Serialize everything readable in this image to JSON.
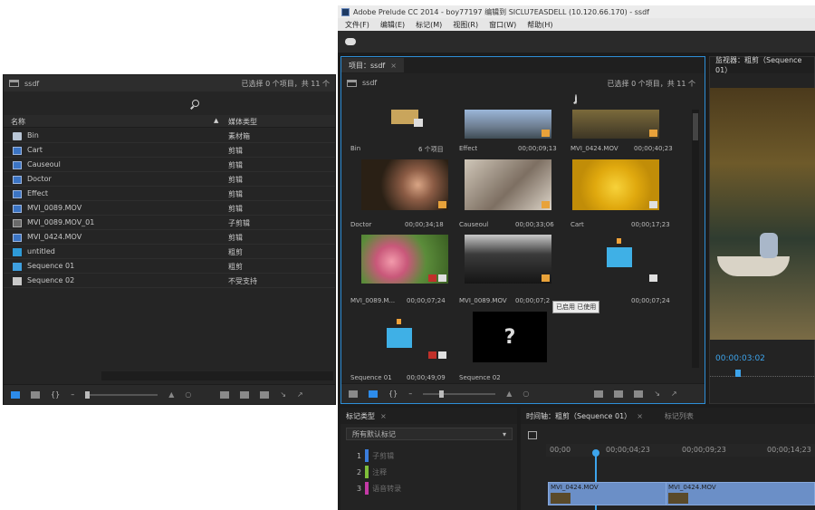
{
  "left_panel": {
    "bin_name": "ssdf",
    "selection_info": "已选择 0 个项目，共 11 个",
    "col_name": "名称",
    "col_type": "媒体类型",
    "rows": [
      {
        "name": "Bin",
        "type": "素材箱",
        "icon": "folder-icon"
      },
      {
        "name": "Cart",
        "type": "剪辑",
        "icon": "clip-icon"
      },
      {
        "name": "Causeoul",
        "type": "剪辑",
        "icon": "clip-icon"
      },
      {
        "name": "Doctor",
        "type": "剪辑",
        "icon": "clip-icon"
      },
      {
        "name": "Effect",
        "type": "剪辑",
        "icon": "clip-icon"
      },
      {
        "name": "MVI_0089.MOV",
        "type": "剪辑",
        "icon": "clip-icon"
      },
      {
        "name": "MVI_0089.MOV_01",
        "type": "子剪辑",
        "icon": "subclip-icon"
      },
      {
        "name": "MVI_0424.MOV",
        "type": "剪辑",
        "icon": "clip-icon"
      },
      {
        "name": "untitled",
        "type": "粗剪",
        "icon": "rough-cut-icon"
      },
      {
        "name": "Sequence 01",
        "type": "粗剪",
        "icon": "sequence-icon"
      },
      {
        "name": "Sequence 02",
        "type": "不受支持",
        "icon": "document-icon"
      }
    ]
  },
  "window": {
    "title": "Adobe Prelude CC 2014 - boy77197 编辑到 SICLU7EASDELL (10.120.66.170) - ssdf",
    "menu": [
      "文件(F)",
      "编辑(E)",
      "标记(M)",
      "视图(R)",
      "窗口(W)",
      "帮助(H)"
    ]
  },
  "project": {
    "tab": "项目：ssdf",
    "bin_name": "ssdf",
    "selection_info": "已选择 0 个项目，共 11 个",
    "tooltip": "已启用 已使用",
    "items": [
      {
        "name": "Bin",
        "duration": "6 个项目"
      },
      {
        "name": "Effect",
        "duration": "00;00;09;13"
      },
      {
        "name": "MVI_0424.MOV",
        "duration": "00;00;40;23"
      },
      {
        "name": "Doctor",
        "duration": "00;00;34;18"
      },
      {
        "name": "Causeoul",
        "duration": "00;00;33;06"
      },
      {
        "name": "Cart",
        "duration": "00;00;17;23"
      },
      {
        "name": "MVI_0089.M...",
        "duration": "00;00;07;24"
      },
      {
        "name": "MVI_0089.MOV",
        "duration": "00;00;07;2"
      },
      {
        "name": "",
        "duration": "00;00;07;24"
      },
      {
        "name": "Sequence 01",
        "duration": "00;00;49;09"
      },
      {
        "name": "Sequence 02",
        "duration": ""
      }
    ]
  },
  "monitor": {
    "tab": "监视器：粗剪（Sequence 01）",
    "timecode": "00:00:03:02"
  },
  "tag_panel": {
    "tab": "标记类型",
    "select_value": "所有默认标记",
    "items": [
      {
        "num": "1",
        "label": "子剪辑",
        "color": "#3b7ddd"
      },
      {
        "num": "2",
        "label": "注释",
        "color": "#7fbf3a"
      },
      {
        "num": "3",
        "label": "语音转录",
        "color": "#c43aa6"
      }
    ]
  },
  "timeline": {
    "tab": "时间轴：粗剪（Sequence 01）",
    "tab2": "标记列表",
    "ruler": [
      "00;00",
      "00;00;04;23",
      "00;00;09;23",
      "00;00;14;23"
    ],
    "clips": [
      "MVI_0424.MOV",
      "MVI_0424.MOV"
    ]
  }
}
